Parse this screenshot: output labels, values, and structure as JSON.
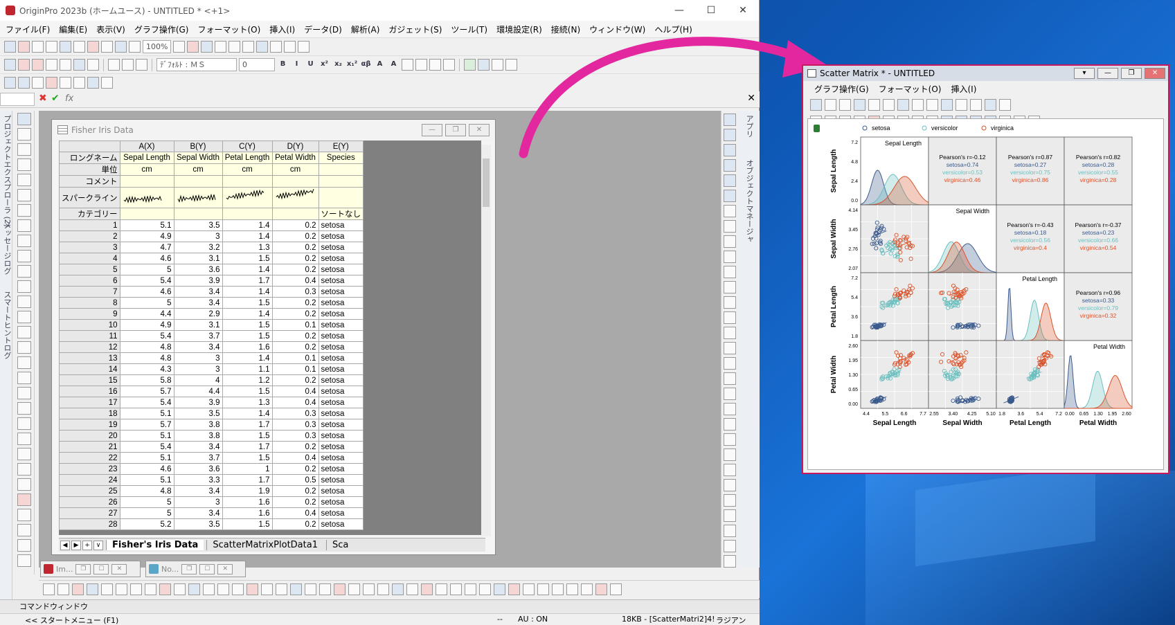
{
  "app": {
    "title": "OriginPro 2023b (ホームユース) - UNTITLED * <+1>",
    "window_controls": [
      "—",
      "☐",
      "✕"
    ]
  },
  "menubar": [
    "ファイル(F)",
    "編集(E)",
    "表示(V)",
    "グラフ操作(G)",
    "フォーマット(O)",
    "挿入(I)",
    "データ(D)",
    "解析(A)",
    "ガジェット(S)",
    "ツール(T)",
    "環境設定(R)",
    "接続(N)",
    "ウィンドウ(W)",
    "ヘルプ(H)"
  ],
  "toolbar": {
    "zoom": "100%",
    "font_name": "ﾃﾞﾌｫﾙﾄ : ＭＳ",
    "font_size": "0",
    "format_buttons": [
      "B",
      "I",
      "U",
      "x²",
      "x₂",
      "x₁²",
      "αβ",
      "A",
      "A"
    ]
  },
  "formula_bar": {
    "cancel": "✖",
    "accept": "✔",
    "fx": "fx",
    "close": "✕"
  },
  "left_tabs": [
    "プロジェクトエクスプローラ (2)",
    "メッセージログ",
    "スマートヒントログ"
  ],
  "right_tabs": [
    "アプリ",
    "オブジェクトマネージャ"
  ],
  "worksheet": {
    "title": "Fisher Iris Data",
    "columns": [
      "A(X)",
      "B(Y)",
      "C(Y)",
      "D(Y)",
      "E(Y)"
    ],
    "row_labels": {
      "longname": "ロングネーム",
      "units": "単位",
      "comment": "コメント",
      "sparkline": "スパークライン",
      "category": "カテゴリー"
    },
    "long_names": [
      "Sepal Length",
      "Sepal Width",
      "Petal Length",
      "Petal Width",
      "Species"
    ],
    "units": [
      "cm",
      "cm",
      "cm",
      "cm",
      ""
    ],
    "categories": [
      "",
      "",
      "",
      "",
      "ソートなし"
    ],
    "rows": [
      [
        1,
        5.1,
        3.5,
        1.4,
        0.2,
        "setosa"
      ],
      [
        2,
        4.9,
        3,
        1.4,
        0.2,
        "setosa"
      ],
      [
        3,
        4.7,
        3.2,
        1.3,
        0.2,
        "setosa"
      ],
      [
        4,
        4.6,
        3.1,
        1.5,
        0.2,
        "setosa"
      ],
      [
        5,
        5,
        3.6,
        1.4,
        0.2,
        "setosa"
      ],
      [
        6,
        5.4,
        3.9,
        1.7,
        0.4,
        "setosa"
      ],
      [
        7,
        4.6,
        3.4,
        1.4,
        0.3,
        "setosa"
      ],
      [
        8,
        5,
        3.4,
        1.5,
        0.2,
        "setosa"
      ],
      [
        9,
        4.4,
        2.9,
        1.4,
        0.2,
        "setosa"
      ],
      [
        10,
        4.9,
        3.1,
        1.5,
        0.1,
        "setosa"
      ],
      [
        11,
        5.4,
        3.7,
        1.5,
        0.2,
        "setosa"
      ],
      [
        12,
        4.8,
        3.4,
        1.6,
        0.2,
        "setosa"
      ],
      [
        13,
        4.8,
        3,
        1.4,
        0.1,
        "setosa"
      ],
      [
        14,
        4.3,
        3,
        1.1,
        0.1,
        "setosa"
      ],
      [
        15,
        5.8,
        4,
        1.2,
        0.2,
        "setosa"
      ],
      [
        16,
        5.7,
        4.4,
        1.5,
        0.4,
        "setosa"
      ],
      [
        17,
        5.4,
        3.9,
        1.3,
        0.4,
        "setosa"
      ],
      [
        18,
        5.1,
        3.5,
        1.4,
        0.3,
        "setosa"
      ],
      [
        19,
        5.7,
        3.8,
        1.7,
        0.3,
        "setosa"
      ],
      [
        20,
        5.1,
        3.8,
        1.5,
        0.3,
        "setosa"
      ],
      [
        21,
        5.4,
        3.4,
        1.7,
        0.2,
        "setosa"
      ],
      [
        22,
        5.1,
        3.7,
        1.5,
        0.4,
        "setosa"
      ],
      [
        23,
        4.6,
        3.6,
        1,
        0.2,
        "setosa"
      ],
      [
        24,
        5.1,
        3.3,
        1.7,
        0.5,
        "setosa"
      ],
      [
        25,
        4.8,
        3.4,
        1.9,
        0.2,
        "setosa"
      ],
      [
        26,
        5,
        3,
        1.6,
        0.2,
        "setosa"
      ],
      [
        27,
        5,
        3.4,
        1.6,
        0.4,
        "setosa"
      ],
      [
        28,
        5.2,
        3.5,
        1.5,
        0.2,
        "setosa"
      ]
    ],
    "sheet_tabs": [
      "Fisher's Iris Data",
      "ScatterMatrixPlotData1",
      "Sca"
    ]
  },
  "minimized": [
    {
      "label": "Im..."
    },
    {
      "label": "No..."
    }
  ],
  "command_window": "コマンドウィンドウ",
  "status": {
    "left": "<< スタートメニュー (F1)",
    "dash": "--",
    "au": "AU : ON",
    "info": "18KB - [ScatterMatri2]4!",
    "unit": "ラジアン"
  },
  "scatter_matrix": {
    "title": "Scatter Matrix * - UNTITLED",
    "menu": [
      "グラフ操作(G)",
      "フォーマット(O)",
      "挿入(I)"
    ],
    "legend": [
      {
        "name": "setosa",
        "color": "#3b5a8c"
      },
      {
        "name": "versicolor",
        "color": "#6bbfbf"
      },
      {
        "name": "virginica",
        "color": "#d9532c"
      }
    ],
    "variables": [
      "Sepal Length",
      "Sepal Width",
      "Petal Length",
      "Petal Width"
    ],
    "x_ticks": [
      [
        "4.4",
        "5.5",
        "6.6",
        "7.7"
      ],
      [
        "2.55",
        "3.40",
        "4.25",
        "5.10"
      ],
      [
        "1.8",
        "3.6",
        "5.4",
        "7.2"
      ],
      [
        "0.00",
        "0.65",
        "1.30",
        "1.95",
        "2.60"
      ]
    ],
    "y_ticks": [
      [
        "7.2",
        "4.8",
        "2.4",
        "0.0"
      ],
      [
        "4.14",
        "3.45",
        "2.76",
        "2.07"
      ],
      [
        "7.2",
        "5.4",
        "3.6",
        "1.8"
      ],
      [
        "2.60",
        "1.95",
        "1.30",
        "0.65",
        "0.00"
      ]
    ],
    "correlations": [
      {
        "row": 0,
        "col": 1,
        "title": "Pearson's r=-0.12",
        "setosa": "setosa=0.74",
        "versicolor": "versicolor=0.53",
        "virginica": "virginica=0.46"
      },
      {
        "row": 0,
        "col": 2,
        "title": "Pearson's r=0.87",
        "setosa": "setosa=0.27",
        "versicolor": "versicolor=0.75",
        "virginica": "virginica=0.86"
      },
      {
        "row": 0,
        "col": 3,
        "title": "Pearson's r=0.82",
        "setosa": "setosa=0.28",
        "versicolor": "versicolor=0.55",
        "virginica": "virginica=0.28"
      },
      {
        "row": 1,
        "col": 2,
        "title": "Pearson's r=-0.43",
        "setosa": "setosa=0.18",
        "versicolor": "versicolor=0.56",
        "virginica": "virginica=0.4"
      },
      {
        "row": 1,
        "col": 3,
        "title": "Pearson's r=-0.37",
        "setosa": "setosa=0.23",
        "versicolor": "versicolor=0.66",
        "virginica": "virginica=0.54"
      },
      {
        "row": 2,
        "col": 3,
        "title": "Pearson's r=0.96",
        "setosa": "setosa=0.33",
        "versicolor": "versicolor=0.79",
        "virginica": "virginica=0.32"
      }
    ]
  },
  "arrow_color": "#e3289f"
}
